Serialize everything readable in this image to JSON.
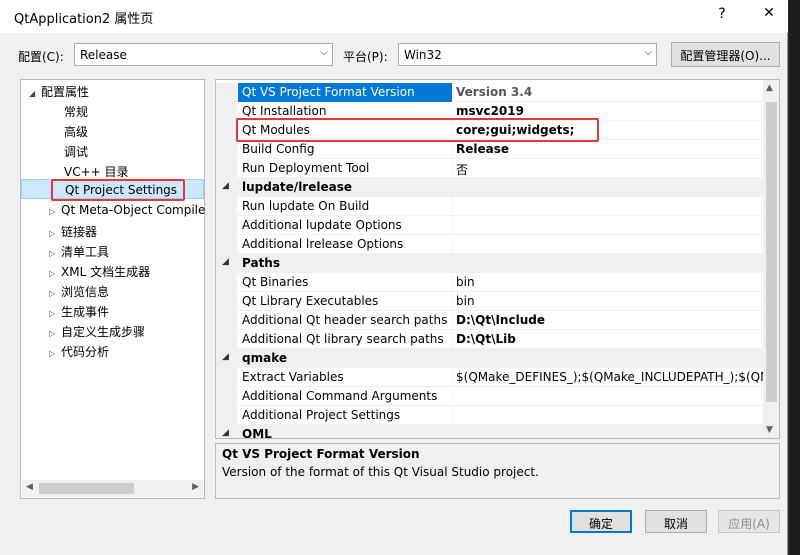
{
  "window": {
    "title": "QtApplication2 属性页",
    "help": "?",
    "close": "✕"
  },
  "config": {
    "label": "配置(C):",
    "value": "Release",
    "platform_label": "平台(P):",
    "platform_value": "Win32",
    "manager_button": "配置管理器(O)..."
  },
  "tree": {
    "root": "配置属性",
    "items": [
      "常规",
      "高级",
      "调试",
      "VC++ 目录",
      "Qt Project Settings",
      "Qt Meta-Object Compile",
      "链接器",
      "清单工具",
      "XML 文档生成器",
      "浏览信息",
      "生成事件",
      "自定义生成步骤",
      "代码分析"
    ]
  },
  "grid": {
    "rows": [
      {
        "type": "prop",
        "name": "Qt VS Project Format Version",
        "value": "Version 3.4",
        "style": "bold-grey",
        "selected": true
      },
      {
        "type": "prop",
        "name": "Qt Installation",
        "value": "msvc2019",
        "style": "bold"
      },
      {
        "type": "prop",
        "name": "Qt Modules",
        "value": "core;gui;widgets;",
        "style": "bold"
      },
      {
        "type": "prop",
        "name": "Build Config",
        "value": "Release",
        "style": "bold"
      },
      {
        "type": "prop",
        "name": "Run Deployment Tool",
        "value": "否",
        "style": ""
      },
      {
        "type": "cat",
        "name": "lupdate/lrelease"
      },
      {
        "type": "prop",
        "name": "Run lupdate On Build",
        "value": "",
        "style": ""
      },
      {
        "type": "prop",
        "name": "Additional lupdate Options",
        "value": "",
        "style": ""
      },
      {
        "type": "prop",
        "name": "Additional lrelease Options",
        "value": "",
        "style": ""
      },
      {
        "type": "cat",
        "name": "Paths"
      },
      {
        "type": "prop",
        "name": "Qt Binaries",
        "value": "bin",
        "style": ""
      },
      {
        "type": "prop",
        "name": "Qt Library Executables",
        "value": "bin",
        "style": ""
      },
      {
        "type": "prop",
        "name": "Additional Qt header search paths",
        "value": "D:\\Qt\\Include",
        "style": "bold"
      },
      {
        "type": "prop",
        "name": "Additional Qt library search paths",
        "value": "D:\\Qt\\Lib",
        "style": "bold"
      },
      {
        "type": "cat",
        "name": "qmake"
      },
      {
        "type": "prop",
        "name": "Extract Variables",
        "value": "$(QMake_DEFINES_);$(QMake_INCLUDEPATH_);$(QMake_",
        "style": ""
      },
      {
        "type": "prop",
        "name": "Additional Command Arguments",
        "value": "",
        "style": ""
      },
      {
        "type": "prop",
        "name": "Additional Project Settings",
        "value": "",
        "style": ""
      },
      {
        "type": "cat",
        "name": "QML"
      }
    ]
  },
  "description": {
    "title": "Qt VS Project Format Version",
    "text": "Version of the format of this Qt Visual Studio project."
  },
  "buttons": {
    "ok": "确定",
    "cancel": "取消",
    "apply": "应用(A)"
  },
  "colors": {
    "selection": "#0078d7",
    "highlight_box": "#e53935"
  }
}
